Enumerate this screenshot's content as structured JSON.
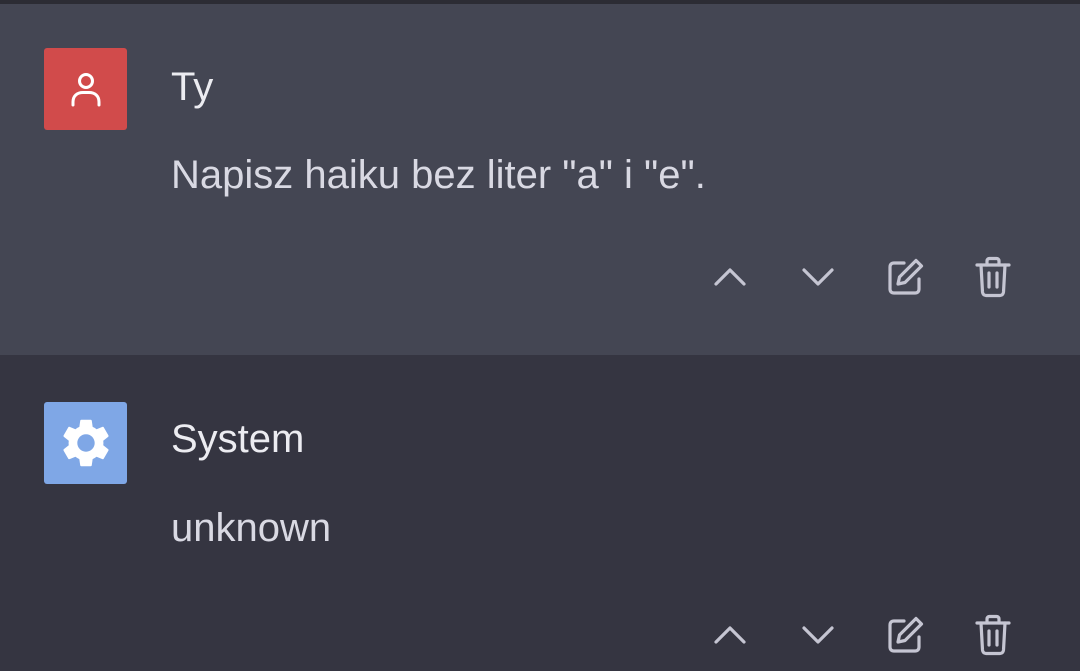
{
  "messages": [
    {
      "author": "Ty",
      "text": "Napisz haiku bez liter \"a\" i \"e\".",
      "avatar_icon": "user-icon",
      "avatar_color": "#d14b4b",
      "background": "#444653"
    },
    {
      "author": "System",
      "text": "unknown",
      "avatar_icon": "gear-icon",
      "avatar_color": "#7fa7e6",
      "background": "#353541"
    }
  ],
  "action_icons": [
    "chevron-up-icon",
    "chevron-down-icon",
    "edit-icon",
    "trash-icon"
  ],
  "colors": {
    "icon": "#c5c5d2",
    "text": "#ececf1"
  }
}
